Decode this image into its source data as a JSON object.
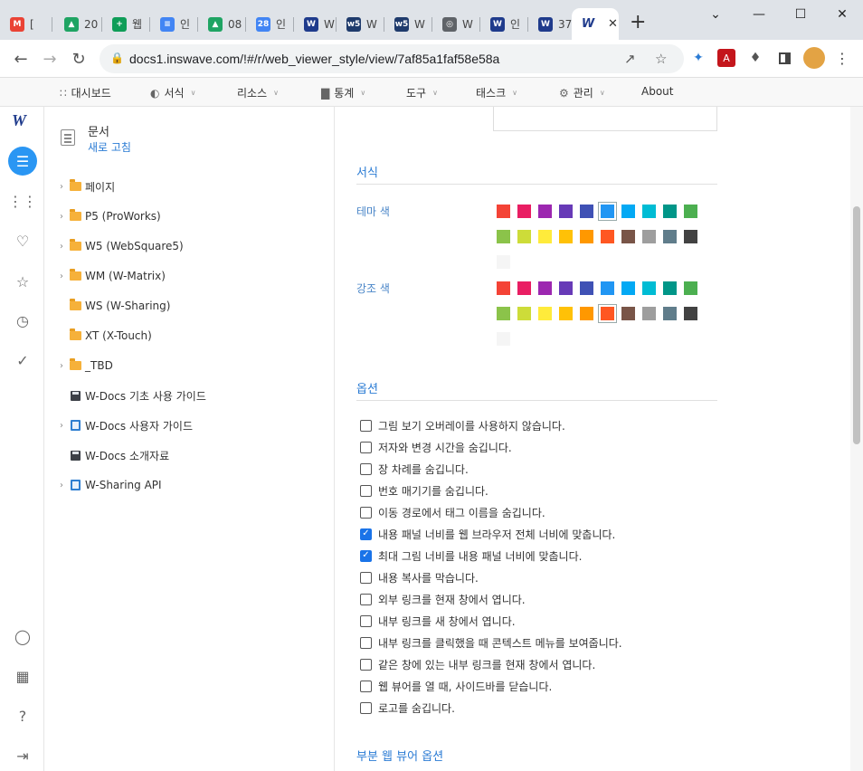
{
  "browser": {
    "tabs": [
      {
        "label": "[",
        "fav_text": "M",
        "fav_color": "#ea4335"
      },
      {
        "label": "20",
        "fav_text": "▲",
        "fav_color": "#1fa463"
      },
      {
        "label": "웹",
        "fav_text": "+",
        "fav_color": "#0f9d58"
      },
      {
        "label": "인",
        "fav_text": "≡",
        "fav_color": "#4285f4"
      },
      {
        "label": "08",
        "fav_text": "▲",
        "fav_color": "#1fa463"
      },
      {
        "label": "인",
        "fav_text": "28",
        "fav_color": "#4285f4"
      },
      {
        "label": "W",
        "fav_text": "W",
        "fav_color": "#1f3b8c"
      },
      {
        "label": "W",
        "fav_text": "w5",
        "fav_color": "#1f3b6c"
      },
      {
        "label": "W",
        "fav_text": "w5",
        "fav_color": "#1f3b6c"
      },
      {
        "label": "W",
        "fav_text": "◎",
        "fav_color": "#5f6368"
      },
      {
        "label": "인",
        "fav_text": "W",
        "fav_color": "#1f3b8c"
      },
      {
        "label": "37",
        "fav_text": "W",
        "fav_color": "#1f3b8c"
      }
    ],
    "active_tab": {
      "fav_text": "W",
      "fav_color": "#1f3b8c",
      "close": "✕"
    },
    "new_tab": "+",
    "window_controls": {
      "collapse": "⌄",
      "minimize": "—",
      "maximize": "☐",
      "close": "✕"
    },
    "url": "docs1.inswave.com/!#/r/web_viewer_style/view/7af85a1faf58e58a"
  },
  "menubar": {
    "items": [
      {
        "label": "대시보드",
        "icon": "dots-grid-icon",
        "caret": false
      },
      {
        "label": "서식",
        "icon": "palette-icon",
        "caret": true
      },
      {
        "label": "리소스",
        "icon": "",
        "caret": true
      },
      {
        "label": "통계",
        "icon": "bar-chart-icon",
        "caret": true
      },
      {
        "label": "도구",
        "icon": "",
        "caret": true
      },
      {
        "label": "태스크",
        "icon": "",
        "caret": true
      },
      {
        "label": "관리",
        "icon": "gear-icon",
        "caret": true
      },
      {
        "label": "About",
        "icon": "",
        "caret": false
      }
    ]
  },
  "tree": {
    "title": "문서",
    "refresh": "새로 고침",
    "items": [
      {
        "label": "페이지",
        "type": "folder",
        "expandable": true
      },
      {
        "label": "P5 (ProWorks)",
        "type": "folder",
        "expandable": true
      },
      {
        "label": "W5 (WebSquare5)",
        "type": "folder",
        "expandable": true
      },
      {
        "label": "WM (W-Matrix)",
        "type": "folder",
        "expandable": true
      },
      {
        "label": "WS (W-Sharing)",
        "type": "folder",
        "expandable": false
      },
      {
        "label": "XT (X-Touch)",
        "type": "folder",
        "expandable": false
      },
      {
        "label": "_TBD",
        "type": "folder",
        "expandable": true
      },
      {
        "label": "W-Docs 기초 사용 가이드",
        "type": "disk",
        "expandable": false
      },
      {
        "label": "W-Docs 사용자 가이드",
        "type": "book",
        "expandable": true
      },
      {
        "label": "W-Docs 소개자료",
        "type": "disk",
        "expandable": false
      },
      {
        "label": "W-Sharing API",
        "type": "book",
        "expandable": true
      }
    ]
  },
  "content": {
    "style_section": "서식",
    "theme_label": "테마 색",
    "accent_label": "강조 색",
    "palette": [
      "#f44336",
      "#e91e63",
      "#9c27b0",
      "#673ab7",
      "#3f51b5",
      "#2196f3",
      "#03a9f4",
      "#00bcd4",
      "#009688",
      "#4caf50",
      "#8bc34a",
      "#cddc39",
      "#ffeb3b",
      "#ffc107",
      "#ff9800",
      "#ff5722",
      "#795548",
      "#9e9e9e",
      "#607d8b",
      "#424242",
      "#f5f5f5"
    ],
    "theme_selected": 5,
    "accent_selected": 15,
    "options_section": "옵션",
    "options": [
      {
        "label": "그림 보기 오버레이를 사용하지 않습니다.",
        "checked": false
      },
      {
        "label": "저자와 변경 시간을 숨깁니다.",
        "checked": false
      },
      {
        "label": "장 차례를 숨깁니다.",
        "checked": false
      },
      {
        "label": "번호 매기기를 숨깁니다.",
        "checked": false
      },
      {
        "label": "이동 경로에서 태그 이름을 숨깁니다.",
        "checked": false
      },
      {
        "label": "내용 패널 너비를 웹 브라우저 전체 너비에 맞춥니다.",
        "checked": true
      },
      {
        "label": "최대 그림 너비를 내용 패널 너비에 맞춥니다.",
        "checked": true
      },
      {
        "label": "내용 복사를 막습니다.",
        "checked": false
      },
      {
        "label": "외부 링크를 현재 창에서 엽니다.",
        "checked": false
      },
      {
        "label": "내부 링크를 새 창에서 엽니다.",
        "checked": false
      },
      {
        "label": "내부 링크를 클릭했을 때 콘텍스트 메뉴를 보여줍니다.",
        "checked": false
      },
      {
        "label": "같은 창에 있는 내부 링크를 현재 창에서 엽니다.",
        "checked": false
      },
      {
        "label": "웹 뷰어를 열 때, 사이드바를 닫습니다.",
        "checked": false
      },
      {
        "label": "로고를 숨깁니다.",
        "checked": false
      }
    ],
    "partial_section": "부분 웹 뷰어 옵션"
  }
}
